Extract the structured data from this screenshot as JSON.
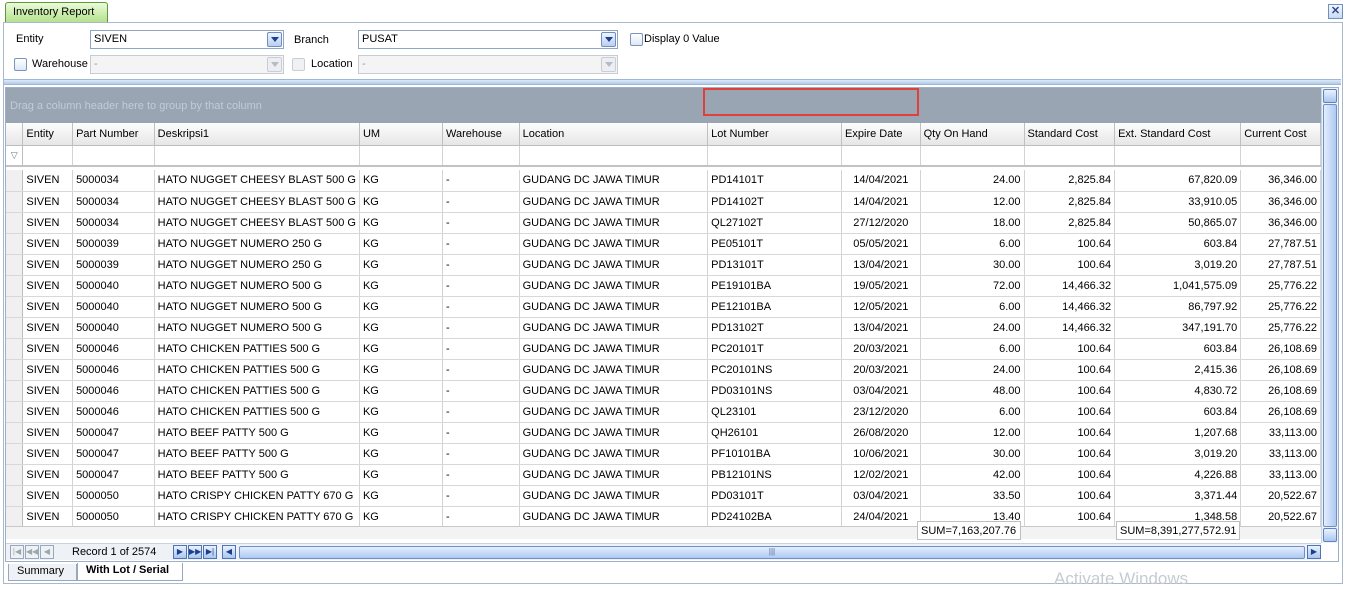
{
  "tab_title": "Inventory Report",
  "filters": {
    "entity_label": "Entity",
    "entity_value": "SIVEN",
    "branch_label": "Branch",
    "branch_value": "PUSAT",
    "display_zero_label": "Display 0 Value",
    "warehouse_label": "Warehouse",
    "warehouse_value": "-",
    "location_label": "Location",
    "location_value": "-"
  },
  "group_hint": "Drag a column header here to group by that column",
  "columns": [
    "Entity",
    "Part Number",
    "Deskripsi1",
    "UM",
    "Warehouse",
    "Location",
    "Lot Number",
    "Expire Date",
    "Qty On Hand",
    "Standard Cost",
    "Ext. Standard Cost",
    "Current Cost"
  ],
  "rows": [
    [
      "SIVEN",
      "5000034",
      "HATO NUGGET CHEESY  BLAST 500 G",
      "KG",
      "-",
      "GUDANG DC JAWA TIMUR",
      "PD14101T",
      "14/04/2021",
      "24.00",
      "2,825.84",
      "67,820.09",
      "36,346.00"
    ],
    [
      "SIVEN",
      "5000034",
      "HATO NUGGET CHEESY  BLAST 500 G",
      "KG",
      "-",
      "GUDANG DC JAWA TIMUR",
      "PD14102T",
      "14/04/2021",
      "12.00",
      "2,825.84",
      "33,910.05",
      "36,346.00"
    ],
    [
      "SIVEN",
      "5000034",
      "HATO NUGGET CHEESY  BLAST 500 G",
      "KG",
      "-",
      "GUDANG DC JAWA TIMUR",
      "QL27102T",
      "27/12/2020",
      "18.00",
      "2,825.84",
      "50,865.07",
      "36,346.00"
    ],
    [
      "SIVEN",
      "5000039",
      "HATO NUGGET NUMERO 250 G",
      "KG",
      "-",
      "GUDANG DC JAWA TIMUR",
      "PE05101T",
      "05/05/2021",
      "6.00",
      "100.64",
      "603.84",
      "27,787.51"
    ],
    [
      "SIVEN",
      "5000039",
      "HATO NUGGET NUMERO 250 G",
      "KG",
      "-",
      "GUDANG DC JAWA TIMUR",
      "PD13101T",
      "13/04/2021",
      "30.00",
      "100.64",
      "3,019.20",
      "27,787.51"
    ],
    [
      "SIVEN",
      "5000040",
      "HATO NUGGET NUMERO 500 G",
      "KG",
      "-",
      "GUDANG DC JAWA TIMUR",
      "PE19101BA",
      "19/05/2021",
      "72.00",
      "14,466.32",
      "1,041,575.09",
      "25,776.22"
    ],
    [
      "SIVEN",
      "5000040",
      "HATO NUGGET NUMERO 500 G",
      "KG",
      "-",
      "GUDANG DC JAWA TIMUR",
      "PE12101BA",
      "12/05/2021",
      "6.00",
      "14,466.32",
      "86,797.92",
      "25,776.22"
    ],
    [
      "SIVEN",
      "5000040",
      "HATO NUGGET NUMERO 500 G",
      "KG",
      "-",
      "GUDANG DC JAWA TIMUR",
      "PD13102T",
      "13/04/2021",
      "24.00",
      "14,466.32",
      "347,191.70",
      "25,776.22"
    ],
    [
      "SIVEN",
      "5000046",
      "HATO CHICKEN PATTIES 500 G",
      "KG",
      "-",
      "GUDANG DC JAWA TIMUR",
      "PC20101T",
      "20/03/2021",
      "6.00",
      "100.64",
      "603.84",
      "26,108.69"
    ],
    [
      "SIVEN",
      "5000046",
      "HATO CHICKEN PATTIES 500 G",
      "KG",
      "-",
      "GUDANG DC JAWA TIMUR",
      "PC20101NS",
      "20/03/2021",
      "24.00",
      "100.64",
      "2,415.36",
      "26,108.69"
    ],
    [
      "SIVEN",
      "5000046",
      "HATO CHICKEN PATTIES 500 G",
      "KG",
      "-",
      "GUDANG DC JAWA TIMUR",
      "PD03101NS",
      "03/04/2021",
      "48.00",
      "100.64",
      "4,830.72",
      "26,108.69"
    ],
    [
      "SIVEN",
      "5000046",
      "HATO CHICKEN PATTIES 500 G",
      "KG",
      "-",
      "GUDANG DC JAWA TIMUR",
      "QL23101",
      "23/12/2020",
      "6.00",
      "100.64",
      "603.84",
      "26,108.69"
    ],
    [
      "SIVEN",
      "5000047",
      "HATO BEEF PATTY 500 G",
      "KG",
      "-",
      "GUDANG DC JAWA TIMUR",
      "QH26101",
      "26/08/2020",
      "12.00",
      "100.64",
      "1,207.68",
      "33,113.00"
    ],
    [
      "SIVEN",
      "5000047",
      "HATO BEEF PATTY 500 G",
      "KG",
      "-",
      "GUDANG DC JAWA TIMUR",
      "PF10101BA",
      "10/06/2021",
      "30.00",
      "100.64",
      "3,019.20",
      "33,113.00"
    ],
    [
      "SIVEN",
      "5000047",
      "HATO BEEF PATTY 500 G",
      "KG",
      "-",
      "GUDANG DC JAWA TIMUR",
      "PB12101NS",
      "12/02/2021",
      "42.00",
      "100.64",
      "4,226.88",
      "33,113.00"
    ],
    [
      "SIVEN",
      "5000050",
      "HATO CRISPY CHICKEN PATTY 670 G",
      "KG",
      "-",
      "GUDANG DC JAWA TIMUR",
      "PD03101T",
      "03/04/2021",
      "33.50",
      "100.64",
      "3,371.44",
      "20,522.67"
    ],
    [
      "SIVEN",
      "5000050",
      "HATO CRISPY CHICKEN PATTY 670 G",
      "KG",
      "-",
      "GUDANG DC JAWA TIMUR",
      "PD24102BA",
      "24/04/2021",
      "13.40",
      "100.64",
      "1,348.58",
      "20,522.67"
    ]
  ],
  "summary": {
    "qty_sum": "SUM=7,163,207.76",
    "ext_sum": "SUM=8,391,277,572.91"
  },
  "navigator": {
    "record_text": "Record 1 of 2574"
  },
  "bottom_tabs": [
    "Summary",
    "With Lot / Serial"
  ],
  "watermark": "Activate Windows",
  "colors": {
    "highlight_box": "#e0403a",
    "tab_green": "#b6e28f"
  }
}
